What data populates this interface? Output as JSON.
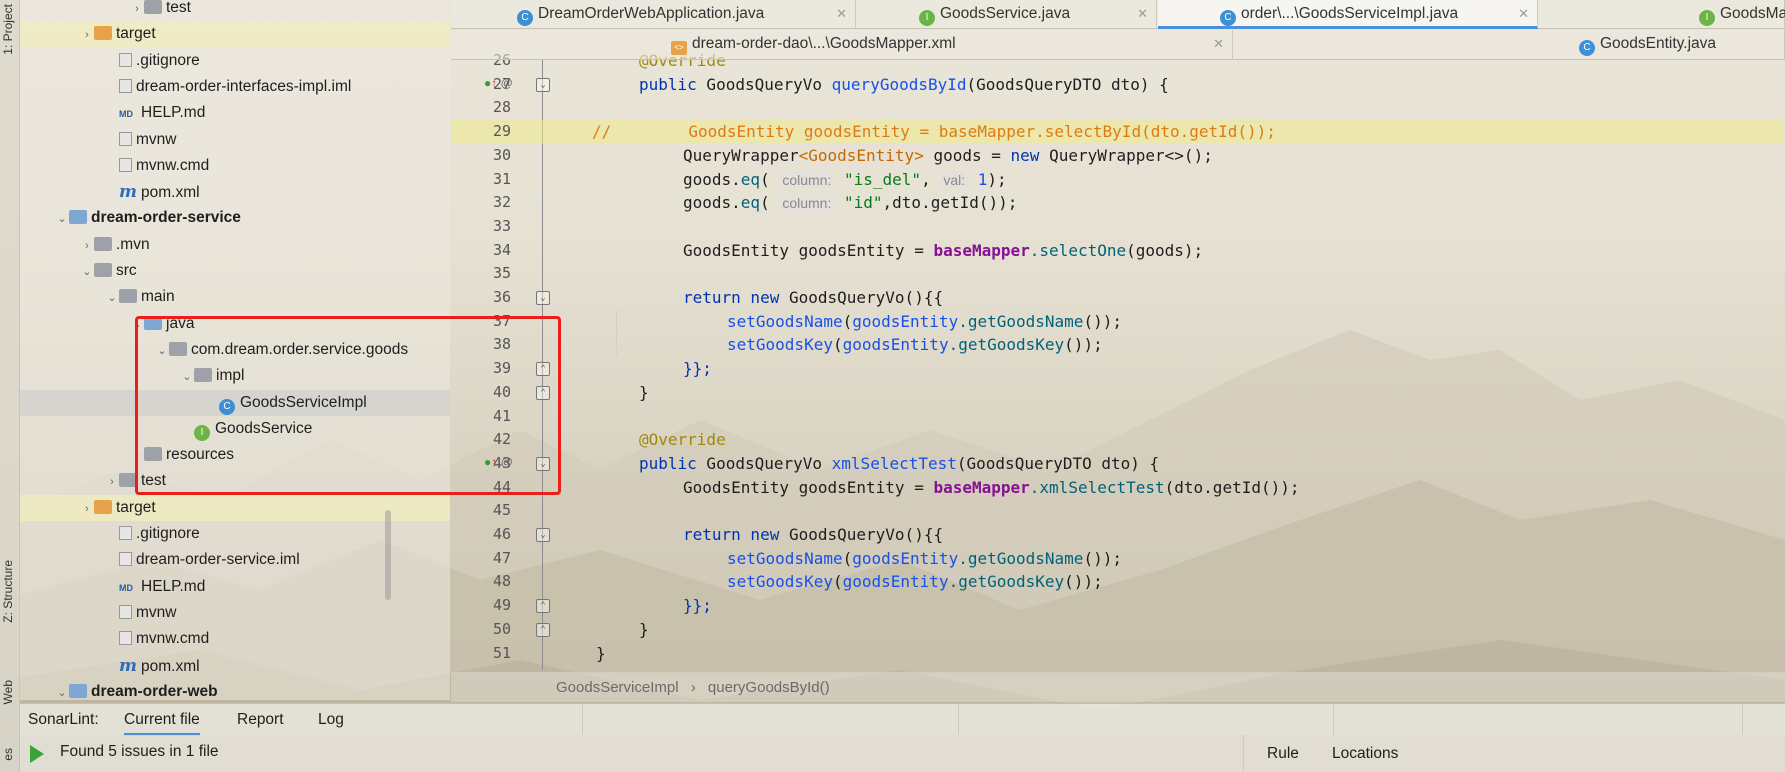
{
  "side_tabs": {
    "project": "1: Project",
    "structure": "Z: Structure",
    "web": "Web",
    "favorites": "es"
  },
  "tree": [
    {
      "indent": 4,
      "arrow": "›",
      "icon": "folder",
      "label": "test"
    },
    {
      "indent": 2,
      "arrow": "›",
      "icon": "folder-orange",
      "label": "target",
      "hl": true
    },
    {
      "indent": 3,
      "arrow": "",
      "icon": "file",
      "label": ".gitignore"
    },
    {
      "indent": 3,
      "arrow": "",
      "icon": "file",
      "label": "dream-order-interfaces-impl.iml"
    },
    {
      "indent": 3,
      "arrow": "",
      "icon": "md",
      "label": "HELP.md"
    },
    {
      "indent": 3,
      "arrow": "",
      "icon": "file",
      "label": "mvnw"
    },
    {
      "indent": 3,
      "arrow": "",
      "icon": "file",
      "label": "mvnw.cmd"
    },
    {
      "indent": 3,
      "arrow": "",
      "icon": "maven",
      "label": "pom.xml"
    },
    {
      "indent": 1,
      "arrow": "⌄",
      "icon": "folder-blue",
      "label": "dream-order-service",
      "bold": true
    },
    {
      "indent": 2,
      "arrow": "›",
      "icon": "folder",
      "label": ".mvn"
    },
    {
      "indent": 2,
      "arrow": "⌄",
      "icon": "folder",
      "label": "src"
    },
    {
      "indent": 3,
      "arrow": "⌄",
      "icon": "folder",
      "label": "main"
    },
    {
      "indent": 4,
      "arrow": "⌄",
      "icon": "folder-blue",
      "label": "java"
    },
    {
      "indent": 5,
      "arrow": "⌄",
      "icon": "folder",
      "label": "com.dream.order.service.goods"
    },
    {
      "indent": 6,
      "arrow": "⌄",
      "icon": "folder",
      "label": "impl"
    },
    {
      "indent": 7,
      "arrow": "",
      "icon": "class",
      "label": "GoodsServiceImpl",
      "sel": true
    },
    {
      "indent": 6,
      "arrow": "",
      "icon": "interface",
      "label": "GoodsService"
    },
    {
      "indent": 4,
      "arrow": "›",
      "icon": "folder",
      "label": "resources"
    },
    {
      "indent": 3,
      "arrow": "›",
      "icon": "folder",
      "label": "test"
    },
    {
      "indent": 2,
      "arrow": "›",
      "icon": "folder-orange",
      "label": "target",
      "hl": true
    },
    {
      "indent": 3,
      "arrow": "",
      "icon": "file",
      "label": ".gitignore"
    },
    {
      "indent": 3,
      "arrow": "",
      "icon": "file",
      "label": "dream-order-service.iml"
    },
    {
      "indent": 3,
      "arrow": "",
      "icon": "md",
      "label": "HELP.md"
    },
    {
      "indent": 3,
      "arrow": "",
      "icon": "file",
      "label": "mvnw"
    },
    {
      "indent": 3,
      "arrow": "",
      "icon": "file",
      "label": "mvnw.cmd"
    },
    {
      "indent": 3,
      "arrow": "",
      "icon": "maven",
      "label": "pom.xml"
    },
    {
      "indent": 1,
      "arrow": "⌄",
      "icon": "folder-blue",
      "label": "dream-order-web",
      "bold": true
    }
  ],
  "tabs_row1": [
    {
      "label": "DreamOrderWebApplication.java",
      "icon": "class"
    },
    {
      "label": "GoodsService.java",
      "icon": "interface"
    },
    {
      "label": "order\\...\\GoodsServiceImpl.java",
      "icon": "class",
      "active": true
    },
    {
      "label": "GoodsMapper.java",
      "icon": "interface"
    }
  ],
  "tabs_row2": [
    {
      "label": "dream-order-dao\\...\\GoodsMapper.xml",
      "icon": "xml"
    },
    {
      "label": "GoodsEntity.java",
      "icon": "class"
    }
  ],
  "code_lines": [
    "26",
    "27",
    "28",
    "29",
    "30",
    "31",
    "32",
    "33",
    "34",
    "35",
    "36",
    "37",
    "38",
    "39",
    "40",
    "41",
    "42",
    "43",
    "44",
    "45",
    "46",
    "47",
    "48",
    "49",
    "50",
    "51"
  ],
  "code": {
    "l26": "@Override",
    "l27_kw": "public",
    "l27_type": "GoodsQueryVo",
    "l27_m": "queryGoodsById",
    "l27_rest": "(GoodsQueryDTO dto) {",
    "l29": "//        GoodsEntity goodsEntity = baseMapper.selectById(dto.getId());",
    "l30_a": "QueryWrapper",
    "l30_b": "<GoodsEntity>",
    "l30_c": " goods = ",
    "l30_new": "new",
    "l30_d": " QueryWrapper<>();",
    "l31_a": "goods.",
    "l31_m": "eq",
    "l31_hint1": "column:",
    "l31_s": "\"is_del\"",
    "l31_hint2": "val:",
    "l31_n": "1",
    "l32_hint": "column:",
    "l32_s": "\"id\"",
    "l32_rest": ",dto.getId());",
    "l34_a": "GoodsEntity goodsEntity = ",
    "l34_f": "baseMapper",
    "l34_m": ".selectOne",
    "l34_rest": "(goods);",
    "l36_kw": "return new",
    "l36_rest": " GoodsQueryVo(){{",
    "l37_m": "setGoodsName",
    "l37_f": "goodsEntity",
    "l37_m2": ".getGoodsName",
    "l37_rest": "());",
    "l38_m": "setGoodsKey",
    "l38_f": "goodsEntity",
    "l38_m2": ".getGoodsKey",
    "l38_rest": "());",
    "l39": "}};",
    "l40": "}",
    "l42": "@Override",
    "l43_kw": "public",
    "l43_type": "GoodsQueryVo",
    "l43_m": "xmlSelectTest",
    "l43_rest": "(GoodsQueryDTO dto) {",
    "l44_a": "GoodsEntity goodsEntity = ",
    "l44_f": "baseMapper",
    "l44_m": ".xmlSelectTest",
    "l44_rest": "(dto.getId());",
    "l46_kw": "return new",
    "l46_rest": " GoodsQueryVo(){{",
    "l47_m": "setGoodsName",
    "l47_f": "goodsEntity",
    "l47_m2": ".getGoodsName",
    "l47_rest": "());",
    "l48_m": "setGoodsKey",
    "l48_f": "goodsEntity",
    "l48_m2": ".getGoodsKey",
    "l48_rest": "());",
    "l49": "}};",
    "l50": "}",
    "l51": "}"
  },
  "breadcrumb": {
    "class": "GoodsServiceImpl",
    "sep": "›",
    "method": "queryGoodsById()"
  },
  "sonar": {
    "label": "SonarLint:",
    "tabs": [
      "Current file",
      "Report",
      "Log"
    ],
    "status": "Found 5 issues in 1 file",
    "columns": [
      "Rule",
      "Locations"
    ]
  },
  "colors": {
    "highlight": "#f0eb8c",
    "red_box": "#e8201a",
    "accent": "#4a8fd8"
  }
}
